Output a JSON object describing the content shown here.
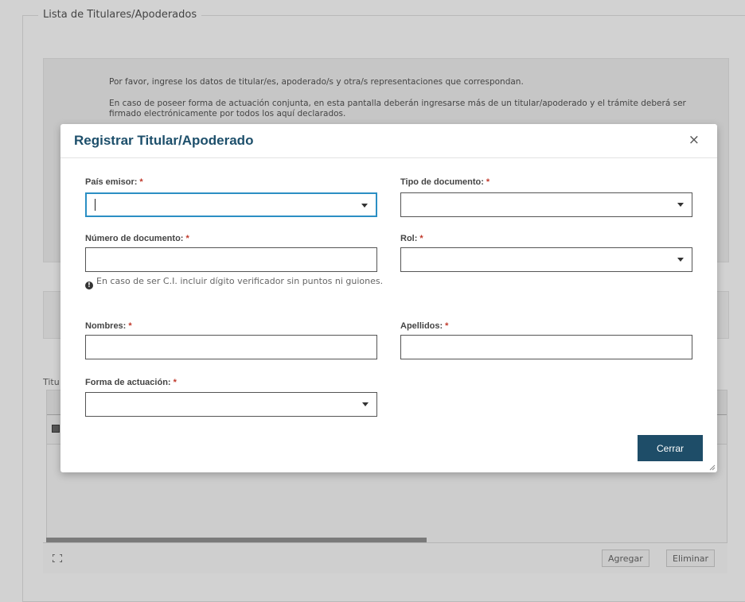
{
  "background": {
    "legend": "Lista de Titulares/Apoderados",
    "info_line1": "Por favor, ingrese los datos de titular/es, apoderado/s y otra/s representaciones que correspondan.",
    "info_line2": "En caso de poseer forma de actuación conjunta, en esta pantalla deberán ingresarse más de un titular/apoderado y el trámite deberá ser firmado electrónicamente por todos los aquí declarados.",
    "table_label": "Titu",
    "add_button": "Agregar",
    "delete_button": "Eliminar"
  },
  "modal": {
    "title": "Registrar Titular/Apoderado",
    "close_icon": "×",
    "fields": {
      "pais_emisor": {
        "label": "País emisor:",
        "required": "*",
        "value": ""
      },
      "tipo_documento": {
        "label": "Tipo de documento:",
        "required": "*",
        "value": ""
      },
      "numero_documento": {
        "label": "Número de documento:",
        "required": "*",
        "value": ""
      },
      "rol": {
        "label": "Rol:",
        "required": "*",
        "value": ""
      },
      "nombres": {
        "label": "Nombres:",
        "required": "*",
        "value": ""
      },
      "apellidos": {
        "label": "Apellidos:",
        "required": "*",
        "value": ""
      },
      "forma_actuacion": {
        "label": "Forma de actuación:",
        "required": "*",
        "value": ""
      }
    },
    "hint": "En caso de ser C.I. incluir dígito verificador sin puntos ni guiones.",
    "hint_icon": "!",
    "close_button": "Cerrar",
    "colors": {
      "title": "#1d4f6b",
      "primary_button": "#1e4d68",
      "focus_border": "#2b8fc4",
      "required": "#c0392b"
    }
  }
}
